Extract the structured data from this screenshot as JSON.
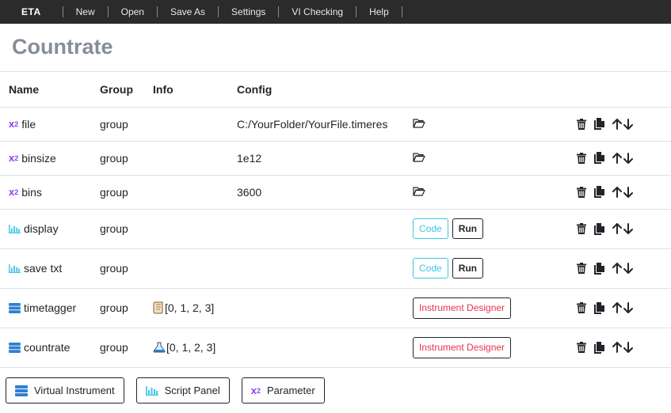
{
  "navbar": {
    "brand": "ETA",
    "items": [
      "New",
      "Open",
      "Save As",
      "Settings",
      "VI Checking",
      "Help"
    ]
  },
  "page": {
    "title": "Countrate"
  },
  "table": {
    "headers": {
      "name": "Name",
      "group": "Group",
      "info": "Info",
      "config": "Config"
    },
    "rows": [
      {
        "icon": "parameter-icon",
        "name": "file",
        "group": "group",
        "info": "",
        "config": "C:/YourFolder/YourFile.timeres",
        "action": "folder"
      },
      {
        "icon": "parameter-icon",
        "name": "binsize",
        "group": "group",
        "info": "",
        "config": "1e12",
        "action": "folder"
      },
      {
        "icon": "parameter-icon",
        "name": "bins",
        "group": "group",
        "info": "",
        "config": "3600",
        "action": "folder"
      },
      {
        "icon": "chart-icon",
        "name": "display",
        "group": "group",
        "info": "",
        "config": "",
        "action": "code-run"
      },
      {
        "icon": "chart-icon",
        "name": "save txt",
        "group": "group",
        "info": "",
        "config": "",
        "action": "code-run"
      },
      {
        "icon": "server-icon",
        "name": "timetagger",
        "group": "group",
        "info_icon": "scroll-icon",
        "info": "[0, 1, 2, 3]",
        "config": "",
        "action": "designer"
      },
      {
        "icon": "server-icon",
        "name": "countrate",
        "group": "group",
        "info_icon": "flask-icon",
        "info": "[0, 1, 2, 3]",
        "config": "",
        "action": "designer"
      }
    ],
    "code_label": "Code",
    "run_label": "Run",
    "designer_label": "Instrument Designer",
    "code_color": "#3cc6e6",
    "designer_color": "#e8324b"
  },
  "bottom_buttons": {
    "virtual_instrument": "Virtual Instrument",
    "script_panel": "Script Panel",
    "parameter": "Parameter"
  },
  "colors": {
    "parameter_icon": "#8a3ffc",
    "chart_icon": "#3cc6e6",
    "server_icon": "#2f80d1",
    "navbar": "#2b2b2b"
  }
}
